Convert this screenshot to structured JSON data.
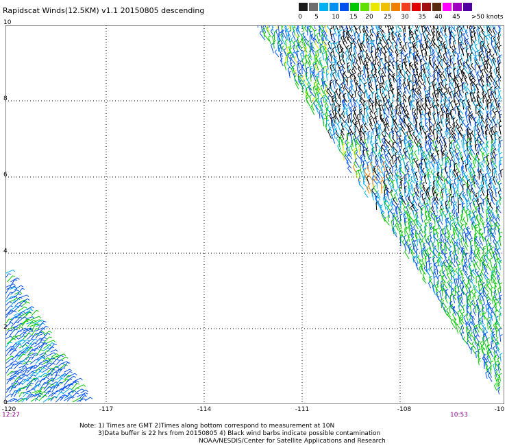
{
  "title": "Rapidscat Winds(12.5KM) v1.1 20150805 descending",
  "legend": {
    "colors": [
      "#1c1c1c",
      "#6e6e6e",
      "#00b0f0",
      "#0090f0",
      "#0050f0",
      "#00c800",
      "#60e000",
      "#e8e800",
      "#f0c000",
      "#f08000",
      "#f04020",
      "#e00000",
      "#a01010",
      "#5a2a10",
      "#ff00ff",
      "#a000c0",
      "#5000a0"
    ],
    "ticks": [
      "0",
      "5",
      "10",
      "15",
      "20",
      "25",
      "30",
      "35",
      "40",
      "45"
    ],
    "unit": ">50 knots"
  },
  "axes": {
    "lat_labels": [
      "10",
      "8",
      "6",
      "4",
      "2",
      "0"
    ],
    "lon_labels": [
      "-120",
      "-117",
      "-114",
      "-111",
      "-108",
      "-10"
    ]
  },
  "times": {
    "left": "12:27",
    "right": "10:53"
  },
  "notes": {
    "line1": "Note: 1) Times are GMT 2)Times along bottom correspond to measurement at 10N",
    "line2": "3)Data buffer is 22 hrs from 20150805 4) Black wind barbs indicate possible contamination",
    "line3": "NOAA/NESDIS/Center for Satellite Applications and Research"
  }
}
